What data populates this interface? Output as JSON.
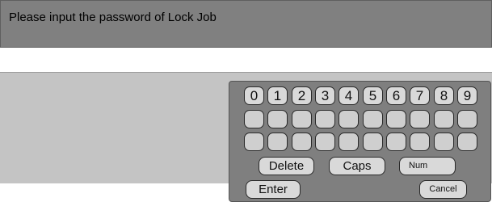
{
  "header": {
    "title": "Please input the password of Lock Job"
  },
  "password": {
    "value": ""
  },
  "keyboard": {
    "digits": [
      "0",
      "1",
      "2",
      "3",
      "4",
      "5",
      "6",
      "7",
      "8",
      "9"
    ],
    "delete_label": "Delete",
    "caps_label": "Caps",
    "num_label": "Num",
    "enter_label": "Enter",
    "cancel_label": "Cancel"
  }
}
